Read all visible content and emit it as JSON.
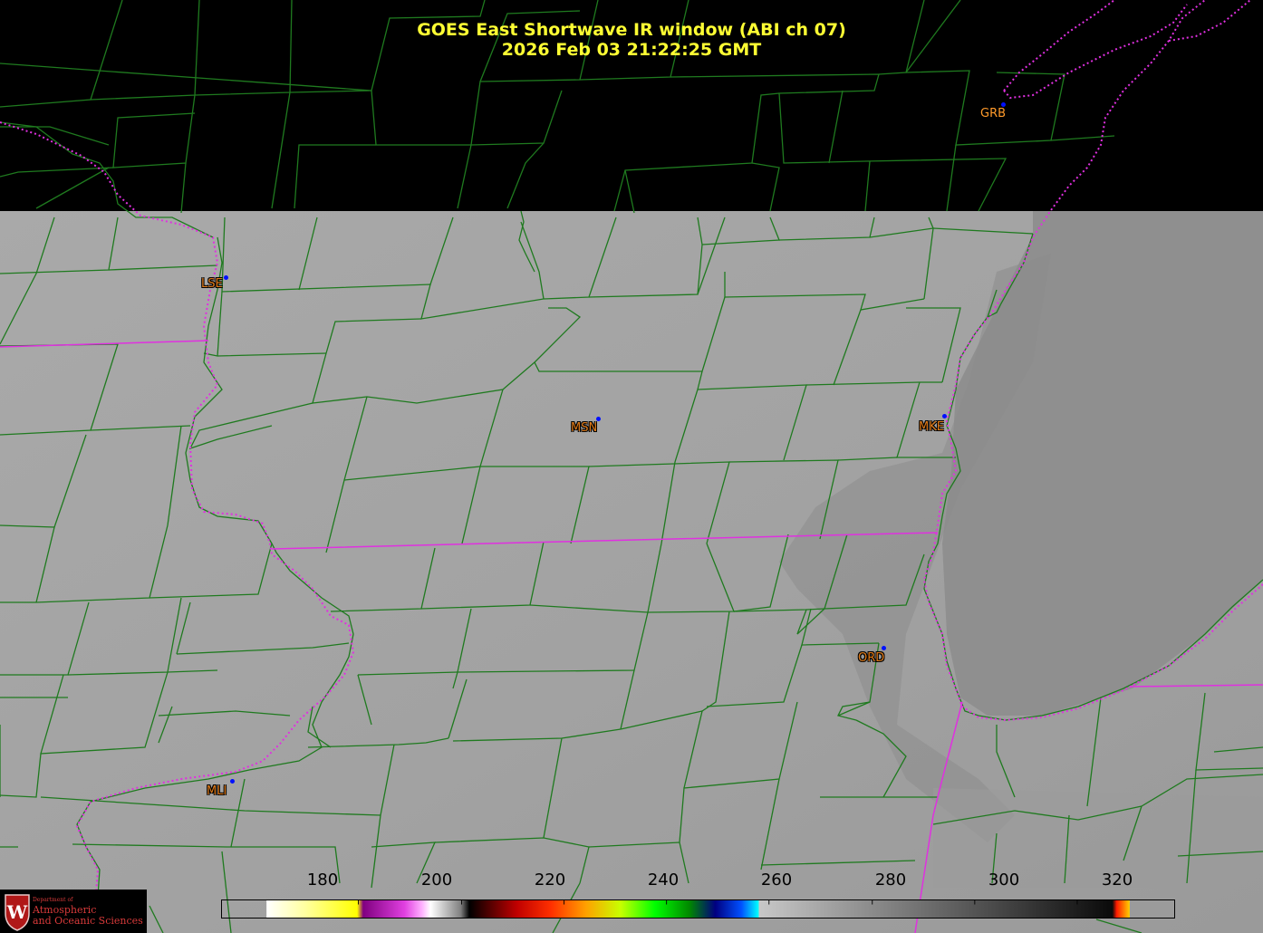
{
  "title": {
    "line1": "GOES East Shortwave IR window (ABI ch 07)",
    "line2": "2026 Feb 03  21:22:25 GMT"
  },
  "stations": [
    {
      "code": "GRB",
      "halo": false
    },
    {
      "code": "LSE",
      "halo": true
    },
    {
      "code": "MSN",
      "halo": true
    },
    {
      "code": "MKE",
      "halo": true
    },
    {
      "code": "ORD",
      "halo": true
    },
    {
      "code": "MLI",
      "halo": true
    }
  ],
  "colorbar": {
    "ticks": [
      "180",
      "200",
      "220",
      "240",
      "260",
      "280",
      "300",
      "320"
    ],
    "colors": {
      "warm_start": "#c8c8c8",
      "warm_end": "#0a0a0a",
      "top_end": "#ff1a00"
    }
  },
  "logo": {
    "line1": "Department of",
    "line2": "Atmospheric",
    "line3": "and Oceanic Sciences",
    "badge": "W"
  },
  "colors": {
    "county_lines": "#1f7a1f",
    "state_lines": "#e030e0",
    "title": "#ffff33",
    "station_dot": "#0010ff"
  }
}
